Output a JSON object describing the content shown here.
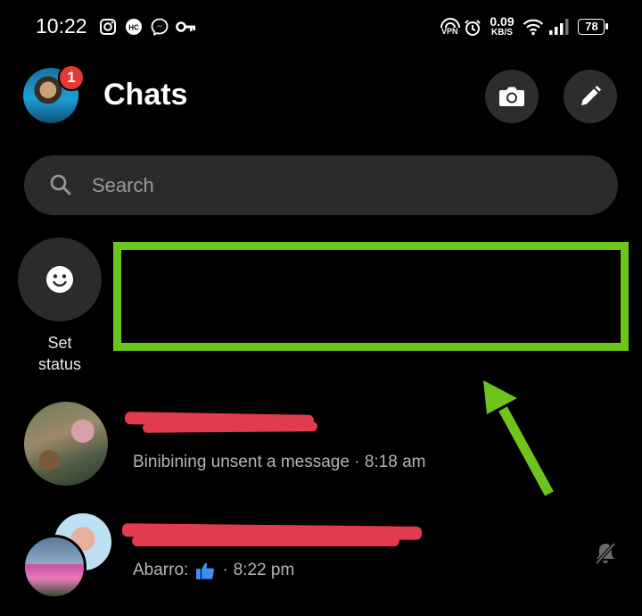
{
  "status_bar": {
    "time": "10:22",
    "speed_value": "0.09",
    "speed_unit": "KB/S",
    "vpn_label": "VPN",
    "battery": "78",
    "left_icons": [
      "instagram-icon",
      "hc-icon",
      "messenger-icon",
      "key-icon"
    ],
    "right_icons": [
      "vpn-icon",
      "alarm-icon",
      "wifi-icon",
      "signal-icon",
      "battery-icon"
    ]
  },
  "header": {
    "title": "Chats",
    "notification_count": "1"
  },
  "search": {
    "placeholder": "Search"
  },
  "status": {
    "label_line1": "Set",
    "label_line2": "status"
  },
  "chats": [
    {
      "preview": "Binibining unsent a message",
      "time": "8:18 am"
    },
    {
      "sender": "Abarro:",
      "time": "8:22 pm",
      "muted": true
    }
  ],
  "colors": {
    "background": "#000000",
    "accent_annotation": "#6fc41c",
    "redaction": "#e23b4d",
    "badge": "#e53935"
  }
}
